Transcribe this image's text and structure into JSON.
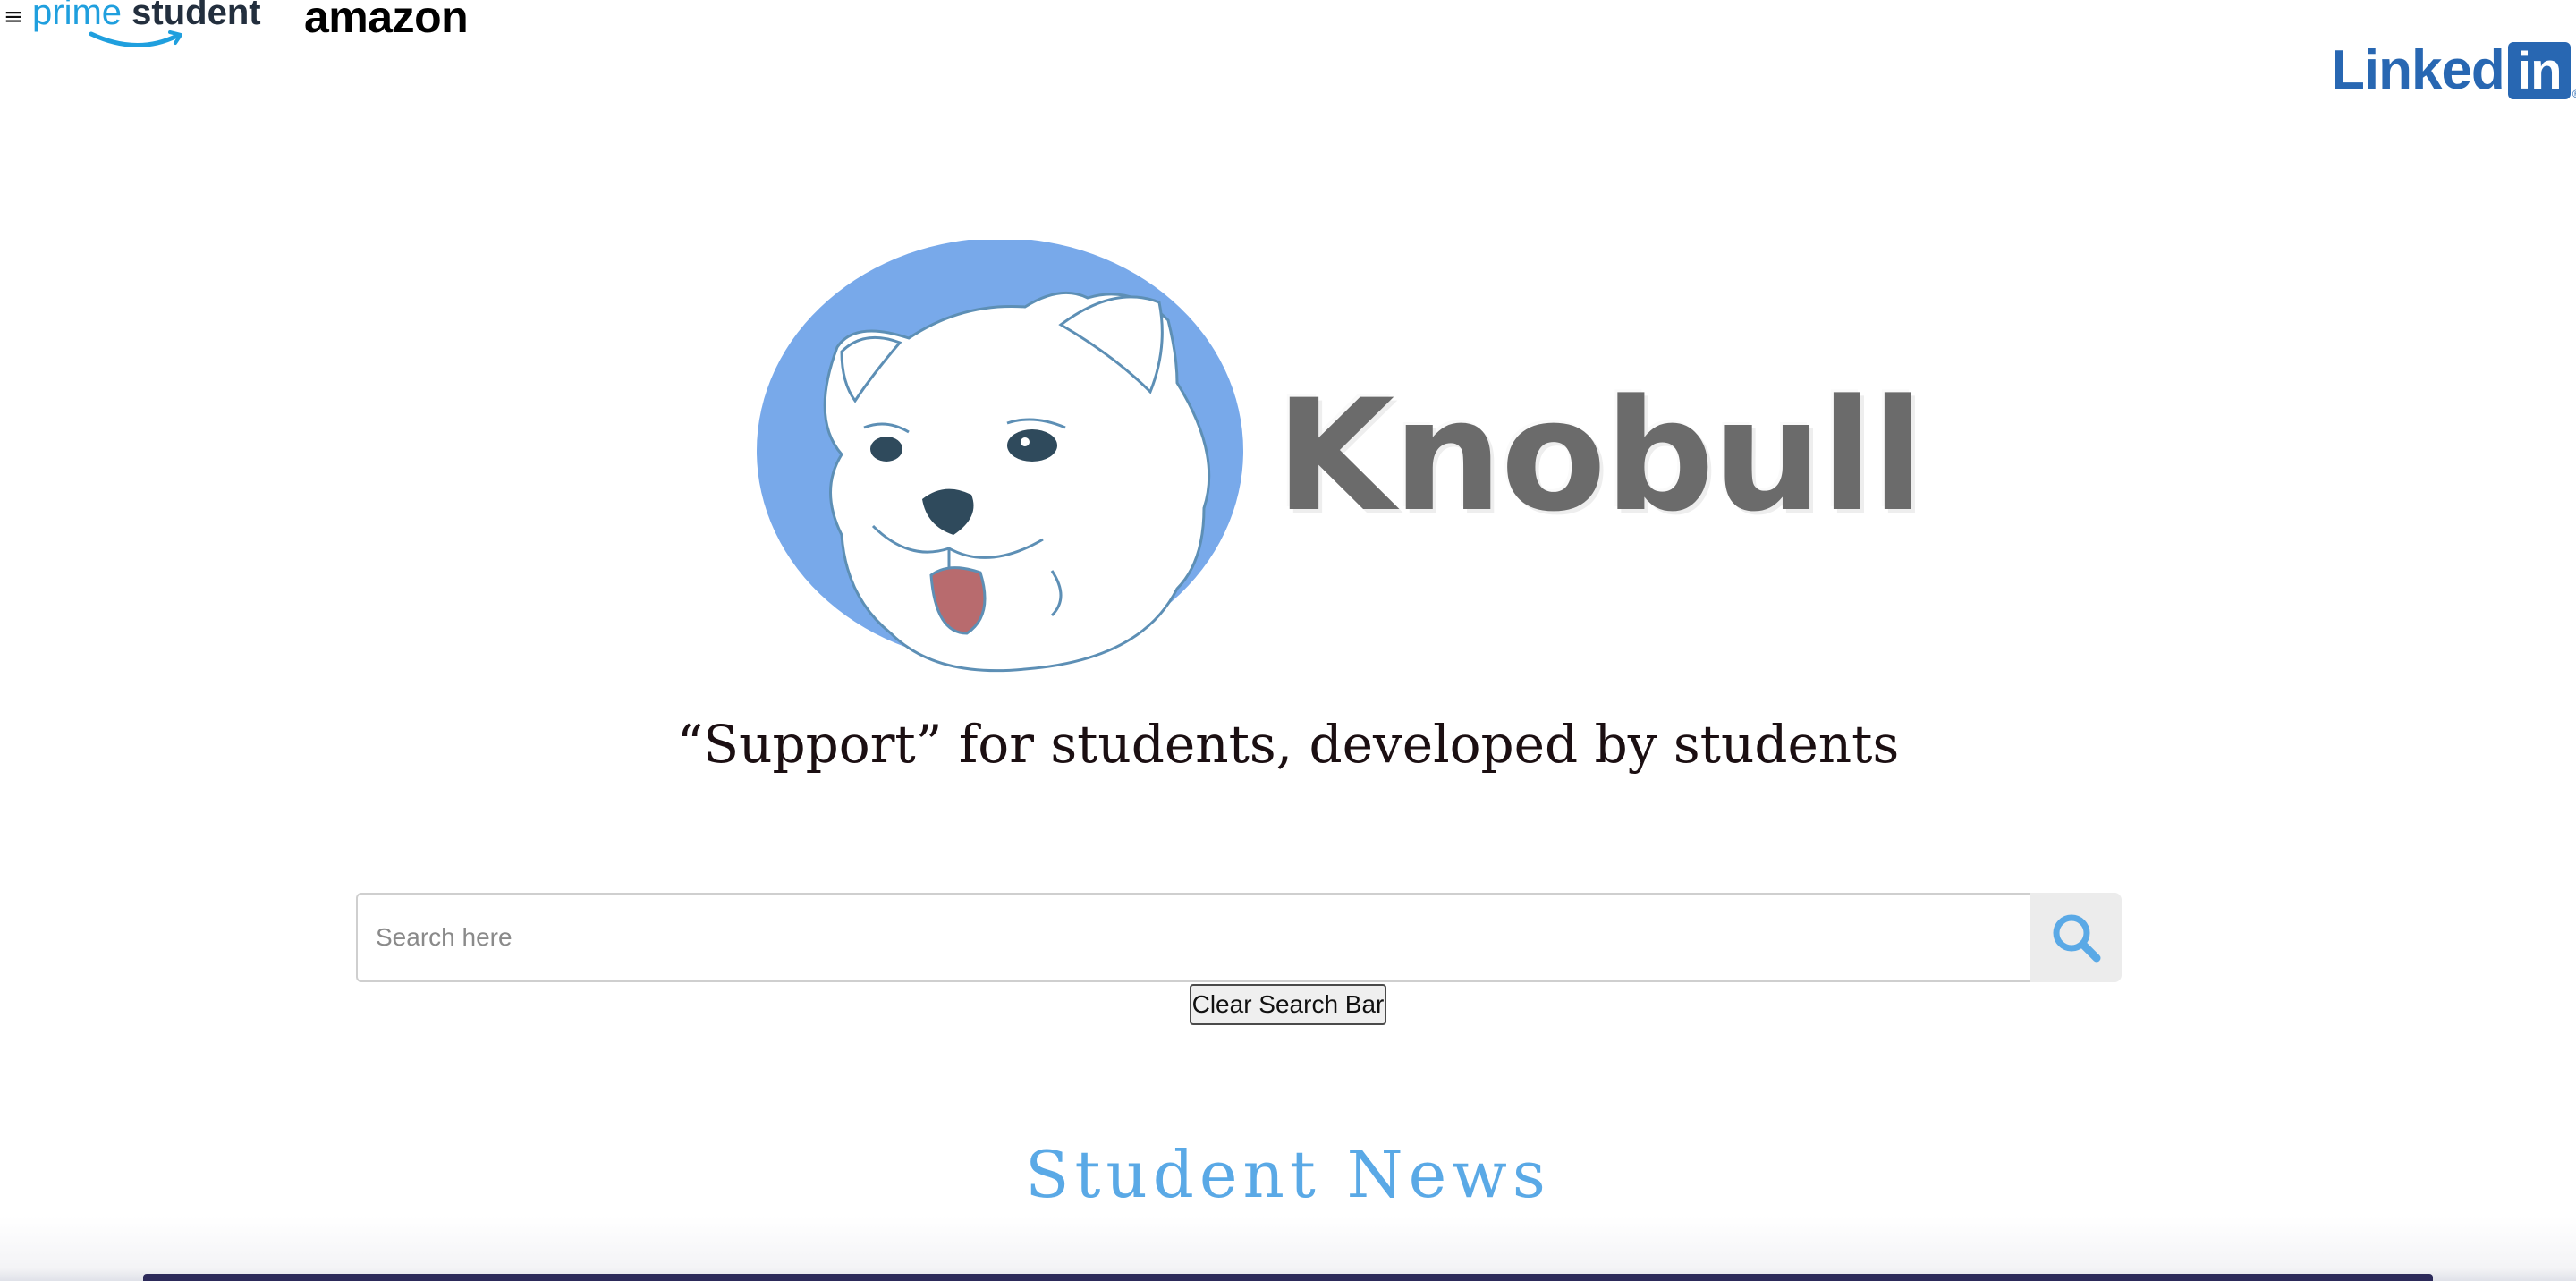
{
  "header": {
    "menu_icon": "hamburger-icon",
    "menu_glyph": "≡",
    "prime_logo": {
      "prime": "prime",
      "student": "student"
    },
    "amazon_label": "amazon",
    "linkedin": {
      "text": "Linked",
      "box": "in",
      "reg": "®",
      "color": "#2867b2"
    }
  },
  "hero": {
    "wordmark": "Knobull",
    "logo_icon": "bulldog-logo-icon",
    "circle_color": "#78a9ea"
  },
  "tagline": "“Support” for students, developed by students",
  "search": {
    "placeholder": "Search here",
    "value": "",
    "button_icon": "search-icon",
    "icon_color": "#5aa9e6",
    "clear_label": "Clear Search Bar"
  },
  "news": {
    "heading": "Student News",
    "color": "#5aa9e6"
  }
}
